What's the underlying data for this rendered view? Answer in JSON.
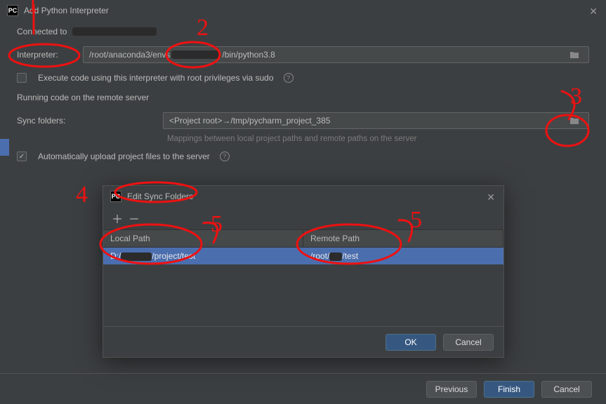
{
  "window": {
    "title": "Add Python Interpreter",
    "connected_label": "Connected to",
    "connected_value_obscured": "",
    "interpreter_label": "Interpreter:",
    "interpreter_value_prefix": "/root/anaconda3/envs",
    "interpreter_value_suffix": "/bin/python3.8",
    "sudo_checkbox_label": "Execute code using this interpreter with root privileges via sudo",
    "section_heading": "Running code on the remote server",
    "sync_label": "Sync folders:",
    "sync_value": "<Project root>→/tmp/pycharm_project_385",
    "sync_hint": "Mappings between local project paths and remote paths on the server",
    "auto_upload_label": "Automatically upload project files to the server"
  },
  "edit_dialog": {
    "title": "Edit Sync Folders",
    "columns": {
      "local": "Local Path",
      "remote": "Remote Path"
    },
    "rows": [
      {
        "local_prefix": "D:/",
        "local_suffix": "/project/test",
        "remote_prefix": "/root/",
        "remote_suffix": "/test"
      }
    ],
    "ok": "OK",
    "cancel": "Cancel"
  },
  "footer": {
    "previous": "Previous",
    "finish": "Finish",
    "cancel": "Cancel"
  },
  "annotations": {
    "n1": "1",
    "n2": "2",
    "n3": "3",
    "n4": "4",
    "n5a": "5",
    "n5b": "5"
  }
}
